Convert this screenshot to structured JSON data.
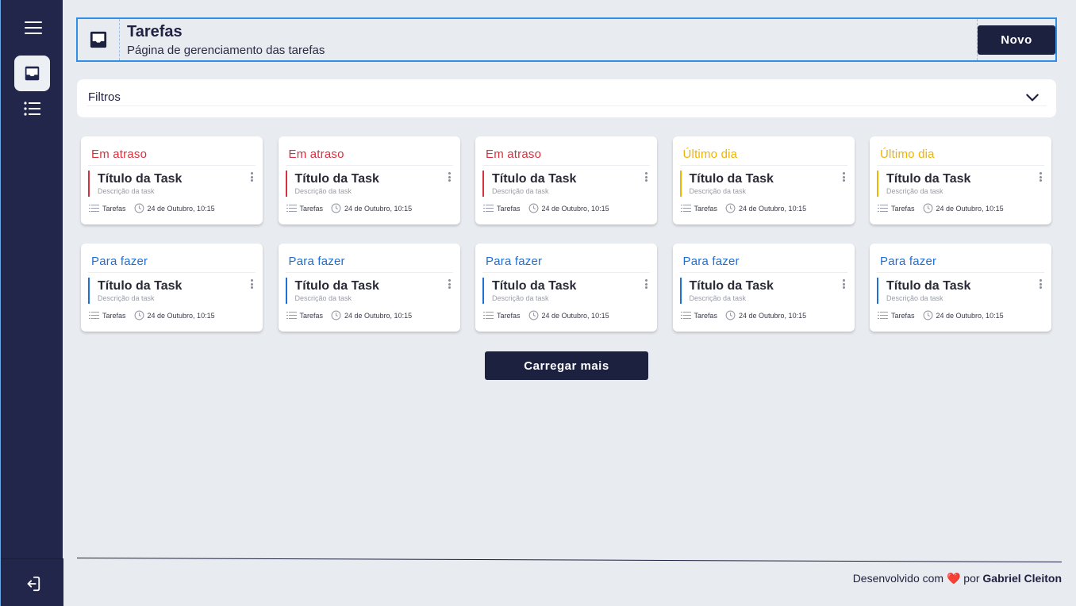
{
  "colors": {
    "overdue": "#d6303f",
    "last_day": "#f0b400",
    "todo": "#1f6fd6",
    "dark": "#1d2140"
  },
  "header": {
    "title": "Tarefas",
    "subtitle": "Página de gerenciamento das tarefas",
    "new_button": "Novo"
  },
  "filters": {
    "label": "Filtros"
  },
  "cards": [
    {
      "status": "Em atraso",
      "kind": "overdue",
      "title": "Título da Task",
      "description": "Descrição da task",
      "category": "Tarefas",
      "datetime": "24 de Outubro, 10:15"
    },
    {
      "status": "Em atraso",
      "kind": "overdue",
      "title": "Título da Task",
      "description": "Descrição da task",
      "category": "Tarefas",
      "datetime": "24 de Outubro, 10:15"
    },
    {
      "status": "Em atraso",
      "kind": "overdue",
      "title": "Título da Task",
      "description": "Descrição da task",
      "category": "Tarefas",
      "datetime": "24 de Outubro, 10:15"
    },
    {
      "status": "Último dia",
      "kind": "last_day",
      "title": "Título da Task",
      "description": "Descrição da task",
      "category": "Tarefas",
      "datetime": "24 de Outubro, 10:15"
    },
    {
      "status": "Último dia",
      "kind": "last_day",
      "title": "Título da Task",
      "description": "Descrição da task",
      "category": "Tarefas",
      "datetime": "24 de Outubro, 10:15"
    },
    {
      "status": "Para fazer",
      "kind": "todo",
      "title": "Título da Task",
      "description": "Descrição da task",
      "category": "Tarefas",
      "datetime": "24 de Outubro, 10:15"
    },
    {
      "status": "Para fazer",
      "kind": "todo",
      "title": "Título da Task",
      "description": "Descrição da task",
      "category": "Tarefas",
      "datetime": "24 de Outubro, 10:15"
    },
    {
      "status": "Para fazer",
      "kind": "todo",
      "title": "Título da Task",
      "description": "Descrição da task",
      "category": "Tarefas",
      "datetime": "24 de Outubro, 10:15"
    },
    {
      "status": "Para fazer",
      "kind": "todo",
      "title": "Título da Task",
      "description": "Descrição da task",
      "category": "Tarefas",
      "datetime": "24 de Outubro, 10:15"
    },
    {
      "status": "Para fazer",
      "kind": "todo",
      "title": "Título da Task",
      "description": "Descrição da task",
      "category": "Tarefas",
      "datetime": "24 de Outubro, 10:15"
    }
  ],
  "load_more": "Carregar mais",
  "footer": {
    "prefix": "Desenvolvido com",
    "heart": "❤️",
    "by": "por",
    "author": "Gabriel Cleiton"
  },
  "icons": {
    "menu": "hamburger-icon",
    "inbox": "inbox-icon",
    "list": "list-icon",
    "logout": "logout-icon",
    "chevron": "chevron-down-icon",
    "more": "more-vertical-icon",
    "clock": "clock-icon"
  }
}
